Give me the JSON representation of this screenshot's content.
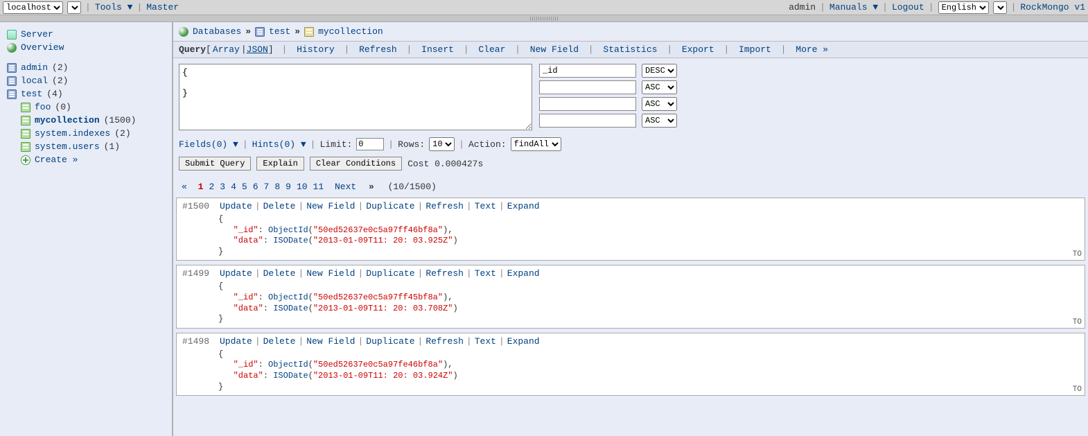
{
  "topbar": {
    "host_options": [
      "localhost"
    ],
    "host_selected": "localhost",
    "tools": "Tools",
    "master": "Master",
    "user": "admin",
    "manuals": "Manuals",
    "logout": "Logout",
    "lang_options": [
      "English"
    ],
    "lang_selected": "English",
    "brand": "RockMongo v1"
  },
  "sidebar": {
    "server": "Server",
    "overview": "Overview",
    "dbs": [
      {
        "name": "admin",
        "count": "(2)"
      },
      {
        "name": "local",
        "count": "(2)"
      },
      {
        "name": "test",
        "count": "(4)",
        "expanded": true
      }
    ],
    "colls": [
      {
        "name": "foo",
        "count": "(0)",
        "bold": false
      },
      {
        "name": "mycollection",
        "count": "(1500)",
        "bold": true
      },
      {
        "name": "system.indexes",
        "count": "(2)",
        "bold": false
      },
      {
        "name": "system.users",
        "count": "(1)",
        "bold": false
      }
    ],
    "create": "Create »"
  },
  "breadcrumb": {
    "root": "Databases",
    "db": "test",
    "coll": "mycollection"
  },
  "tabs": {
    "query": "Query",
    "modes_prefix": "[",
    "mode_array": "Array",
    "mode_json": "JSON",
    "modes_suffix": "]",
    "items": [
      "History",
      "Refresh",
      "Insert",
      "Clear",
      "New Field",
      "Statistics",
      "Export",
      "Import",
      "More »"
    ]
  },
  "query": {
    "text": "{\n\n}",
    "sort": [
      {
        "field": "_id",
        "dir": "DESC"
      },
      {
        "field": "",
        "dir": "ASC"
      },
      {
        "field": "",
        "dir": "ASC"
      },
      {
        "field": "",
        "dir": "ASC"
      }
    ],
    "dir_options": [
      "ASC",
      "DESC"
    ]
  },
  "controls": {
    "fields": "Fields(0)",
    "hints": "Hints(0)",
    "limit_label": "Limit:",
    "limit_value": "0",
    "rows_label": "Rows:",
    "rows_value": "10",
    "rows_options": [
      "10"
    ],
    "action_label": "Action:",
    "action_value": "findAll",
    "action_options": [
      "findAll"
    ]
  },
  "buttons": {
    "submit": "Submit Query",
    "explain": "Explain",
    "clear": "Clear Conditions",
    "cost": "Cost 0.000427s"
  },
  "pager": {
    "laquo": "«",
    "pages": [
      "1",
      "2",
      "3",
      "4",
      "5",
      "6",
      "7",
      "8",
      "9",
      "10",
      "11"
    ],
    "current": "1",
    "next": "Next",
    "raquo": "»",
    "total": "(10/1500)"
  },
  "rec_actions": [
    "Update",
    "Delete",
    "New Field",
    "Duplicate",
    "Refresh",
    "Text",
    "Expand"
  ],
  "records": [
    {
      "num": "#1500",
      "id_key": "\"_id\"",
      "id_fn": "ObjectId",
      "id_val": "\"50ed52637e0c5a97ff46bf8a\"",
      "data_key": "\"data\"",
      "data_fn": "ISODate",
      "data_val": "\"2013-01-09T11: 20: 03.925Z\"",
      "tright": "TO"
    },
    {
      "num": "#1499",
      "id_key": "\"_id\"",
      "id_fn": "ObjectId",
      "id_val": "\"50ed52637e0c5a97ff45bf8a\"",
      "data_key": "\"data\"",
      "data_fn": "ISODate",
      "data_val": "\"2013-01-09T11: 20: 03.708Z\"",
      "tright": "TO"
    },
    {
      "num": "#1498",
      "id_key": "\"_id\"",
      "id_fn": "ObjectId",
      "id_val": "\"50ed52637e0c5a97fe46bf8a\"",
      "data_key": "\"data\"",
      "data_fn": "ISODate",
      "data_val": "\"2013-01-09T11: 20: 03.924Z\"",
      "tright": "TO"
    }
  ]
}
